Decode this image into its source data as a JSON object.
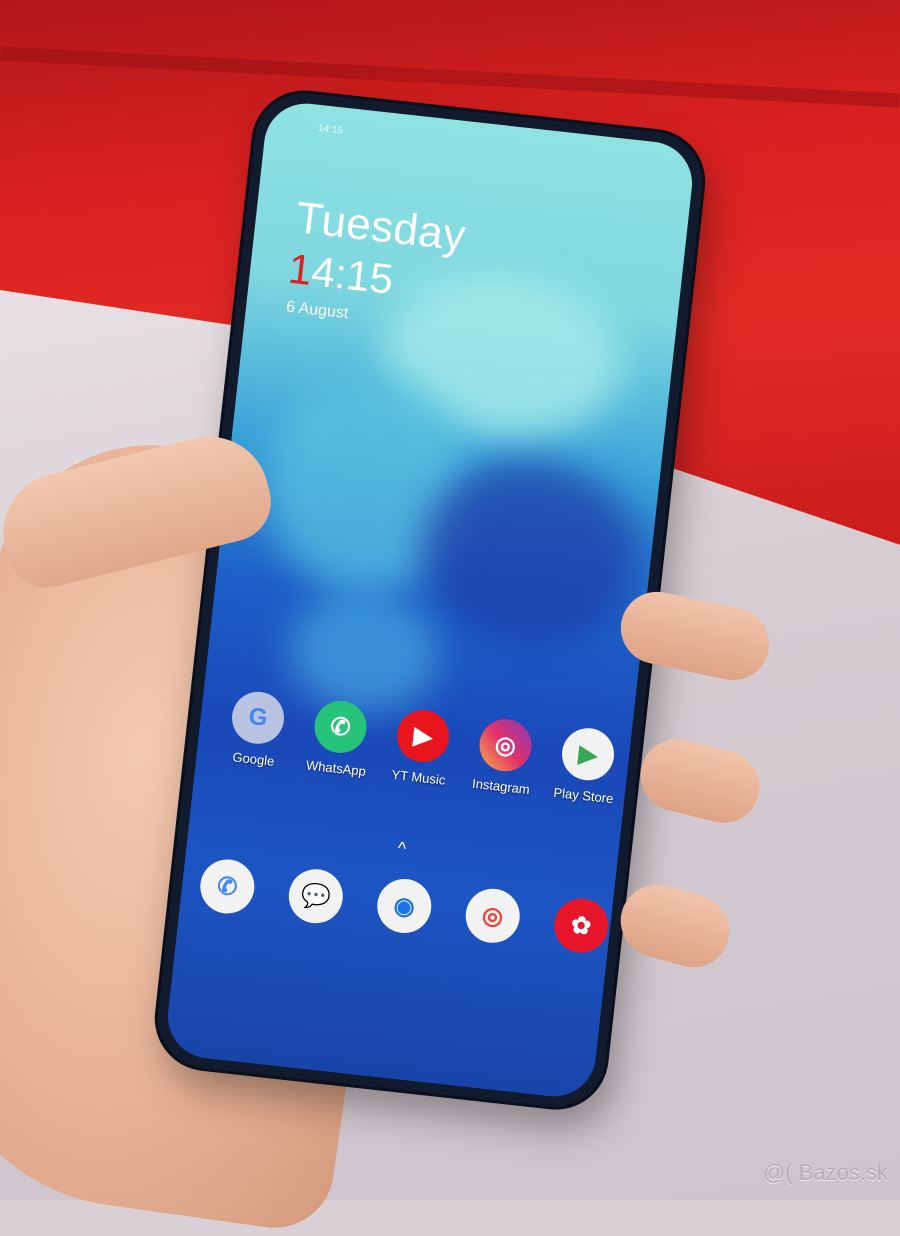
{
  "phone": {
    "status_bar": {
      "time": "14:15"
    },
    "lockscreen_widget": {
      "day": "Tuesday",
      "time_first_digit": "1",
      "time_rest": "4:15",
      "date": "6 August"
    },
    "home_apps": [
      {
        "label": "Google",
        "icon": "google-folder-icon",
        "color": "#b7c3e0",
        "glyph": "G"
      },
      {
        "label": "WhatsApp",
        "icon": "whatsapp-icon",
        "color": "#25c47a",
        "glyph": "✆"
      },
      {
        "label": "YT Music",
        "icon": "youtube-music-icon",
        "color": "#e8161c",
        "glyph": "▶"
      },
      {
        "label": "Instagram",
        "icon": "instagram-icon",
        "color": "#e1306c",
        "glyph": "◎"
      },
      {
        "label": "Play Store",
        "icon": "play-store-icon",
        "color": "#f2f2f2",
        "glyph": "▶"
      }
    ],
    "app_drawer_indicator": "^",
    "dock": [
      {
        "name": "phone-icon",
        "color": "#f2f2f2",
        "glyph": "✆"
      },
      {
        "name": "messages-icon",
        "color": "#f2f2f2",
        "glyph": "💬"
      },
      {
        "name": "chrome-icon",
        "color": "#f2f2f2",
        "glyph": "◉"
      },
      {
        "name": "photos-icon",
        "color": "#f2f2f2",
        "glyph": "◎"
      },
      {
        "name": "gallery-icon",
        "color": "#e8162a",
        "glyph": "✿"
      }
    ]
  },
  "watermark": "@( Bazos.sk"
}
